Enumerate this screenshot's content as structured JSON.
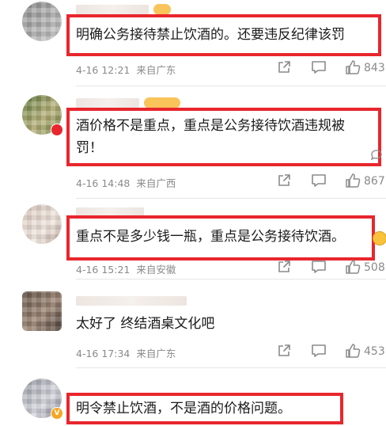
{
  "comments": [
    {
      "text": "明确公务接待禁止饮酒的。还要违反纪律该罚",
      "time": "4-16 12:21",
      "location": "来自广东",
      "likes": "843"
    },
    {
      "text": "酒价格不是重点，重点是公务接待饮酒违规被罚！",
      "time": "4-16 14:48",
      "location": "来自广西",
      "likes": "867"
    },
    {
      "text": "重点不是多少钱一瓶，重点是公务接待饮酒。",
      "time": "4-16 15:21",
      "location": "来自安徽",
      "likes": "508"
    },
    {
      "text": "太好了 终结酒桌文化吧",
      "time": "4-16 17:34",
      "location": "来自广东",
      "likes": "453"
    },
    {
      "text": "明令禁止饮酒，不是酒的价格问题。"
    }
  ],
  "colors": {
    "highlight_border": "#e8262d",
    "meta_text": "#8a8a8a",
    "vip_badge": "#f5a623"
  },
  "icons": {
    "share": "share-icon",
    "comment": "comment-icon",
    "like": "like-icon"
  }
}
